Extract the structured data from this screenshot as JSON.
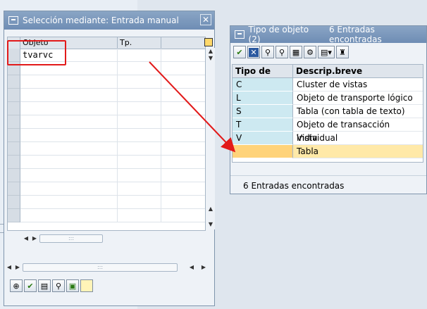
{
  "dialog1": {
    "title": "Selección mediante: Entrada manual",
    "close_glyph": "✕",
    "columns": [
      "Objeto",
      "Tp."
    ],
    "rows": [
      {
        "objeto": "tvarvc",
        "tp": ""
      },
      {
        "objeto": "",
        "tp": ""
      },
      {
        "objeto": "",
        "tp": ""
      },
      {
        "objeto": "",
        "tp": ""
      },
      {
        "objeto": "",
        "tp": ""
      },
      {
        "objeto": "",
        "tp": ""
      },
      {
        "objeto": "",
        "tp": ""
      },
      {
        "objeto": "",
        "tp": ""
      },
      {
        "objeto": "",
        "tp": ""
      },
      {
        "objeto": "",
        "tp": ""
      },
      {
        "objeto": "",
        "tp": ""
      },
      {
        "objeto": "",
        "tp": ""
      },
      {
        "objeto": "",
        "tp": ""
      }
    ],
    "toolbar_icons": [
      "execute-icon",
      "check-icon",
      "print-icon",
      "binoculars-icon",
      "import-icon",
      "note-icon"
    ]
  },
  "dialog2": {
    "title": "Tipo de objeto (2)",
    "title_count": "6 Entradas encontradas",
    "columns": [
      "Tipo de objeto",
      "Descrip.breve"
    ],
    "rows": [
      {
        "code": "C",
        "desc": "Cluster de vistas",
        "selected": false
      },
      {
        "code": "L",
        "desc": "Objeto de transporte lógico",
        "selected": false
      },
      {
        "code": "S",
        "desc": "Tabla (con tabla de texto)",
        "selected": false
      },
      {
        "code": "T",
        "desc": "Objeto de transacción individual",
        "selected": false
      },
      {
        "code": "V",
        "desc": "Vista",
        "selected": false
      },
      {
        "code": "",
        "desc": "Tabla",
        "selected": true
      }
    ],
    "status": "6 Entradas encontradas",
    "toolbar_icons": [
      "check-icon",
      "cancel-icon",
      "binoculars-icon",
      "binoculars-next-icon",
      "export-icon",
      "settings-icon",
      "print-dropdown-icon",
      "pin-icon"
    ]
  },
  "colors": {
    "titlebar": "#7b97bd",
    "highlight": "#e21a1a",
    "code_col": "#cde9f1",
    "selected_code": "#ffd37a",
    "selected_desc": "#ffe9a8"
  }
}
